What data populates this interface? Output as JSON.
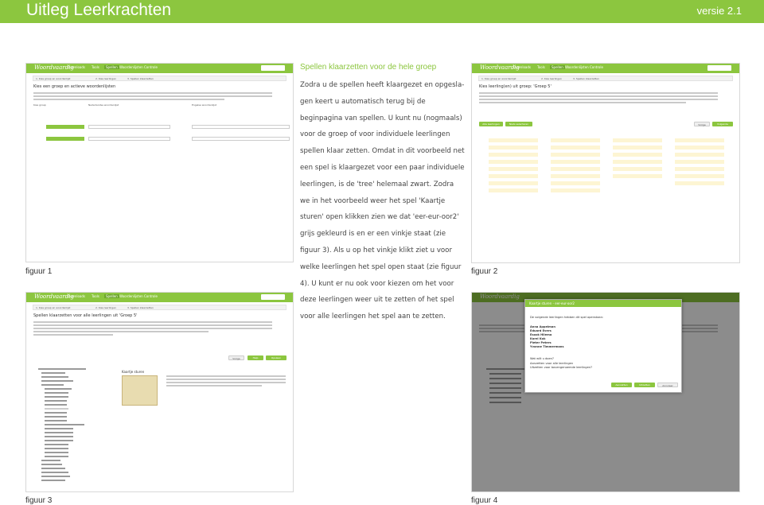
{
  "header": {
    "title": "Uitleg Leerkrachten",
    "version": "versie 2.1"
  },
  "section": {
    "heading": "Spellen klaarzetten voor de hele groep",
    "body": "Zodra u de spellen heeft klaargezet en opgesla- gen keert u automatisch terug bij de beginpagina van spellen. U kunt nu (nogmaals) voor de groep of voor individuele leerlingen spellen klaar zetten. Omdat in dit voorbeeld net een spel is klaargezet voor een paar individuele leerlingen, is de 'tree' helemaal zwart. Zodra we in het voorbeeld weer het spel 'Kaartje sturen' open klikken zien we dat 'eer-eur-oor2' grijs gekleurd is en er een vinkje staat (zie figuur 3). Als u op het vinkje klikt ziet u voor welke leerlingen het spel open staat (zie figuur 4). U kunt er nu ook voor kiezen om het voor deze leerlingen weer uit te zetten of het spel voor alle leerlingen het spel aan te zetten."
  },
  "captions": {
    "fig1": "figuur 1",
    "fig2": "figuur 2",
    "fig3": "figuur 3",
    "fig4": "figuur 4"
  },
  "app": {
    "logo": "Woordvaardig",
    "nav": [
      "Downloads",
      "Tools",
      "Spellen",
      "Woordenlijsten",
      "Controle"
    ],
    "user_button": "Willemien"
  },
  "fig1": {
    "crumbs": [
      "1. Kies groep en woordenlijst",
      "2. Kies leerlingen",
      "3. Spellen klaarzetten"
    ],
    "heading": "Kies een groep en actieve woordenlijsten",
    "col_headers": [
      "Kies groep",
      "Nederlandse woordenlijst",
      "Engelse woordenlijst"
    ],
    "rows": [
      {
        "group": "Groep 5",
        "list": "week 32",
        "english": "--Kies een Engelse woordenlijst--"
      },
      {
        "group": "Groep 6",
        "list": "week 26",
        "english": "--Kies een Engelse woordenlijst--"
      }
    ]
  },
  "fig2": {
    "crumbs": [
      "1. Kies groep en woordenlijst",
      "2. Kies leerlingen",
      "3. Spellen klaarzetten"
    ],
    "heading": "Kies leerling(en) uit groep: 'Groep 5'",
    "buttons": {
      "all": "Alle leerlingen",
      "none": "Niets selecteren",
      "back": "Vorige",
      "next": "Volgende"
    }
  },
  "fig3": {
    "crumbs": [
      "1. Kies groep en woordenlijst",
      "2. Kies leerlingen",
      "3. Spellen klaarzetten"
    ],
    "heading": "Spellen klaarzetten voor alle leerlingen uit 'Groep 5'",
    "card_title": "Kaartje sturen",
    "buttons": {
      "back": "Vorige",
      "help": "Help",
      "save": "Opslaan"
    }
  },
  "fig4": {
    "modal_title": "Kaartje sturen - eer-eur-oor2",
    "intro": "De volgende leerlingen hebben dit spel openstaan:",
    "students": [
      "Anna Appelman",
      "Eduard Evers",
      "Esook Hilema",
      "Karel Kok",
      "Pieter Peters",
      "Yvonne Timmermans"
    ],
    "question": "Wat wilt u doen?",
    "options": [
      "Aanzetten voor alle leerlingen",
      "Uitzetten voor bovengenoemde leerlingen?"
    ],
    "buttons": {
      "on": "Aanzetten",
      "off": "Uitzetten",
      "cancel": "Annuleer"
    }
  }
}
